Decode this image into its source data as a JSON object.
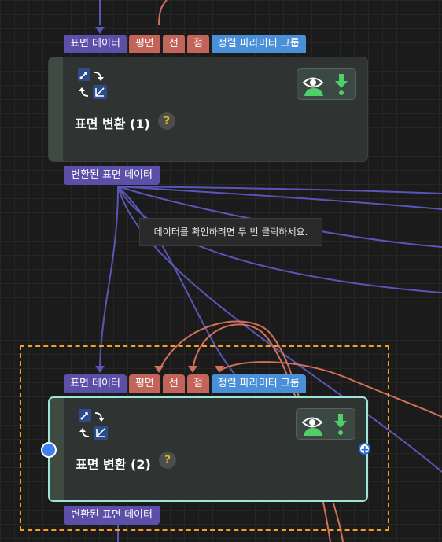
{
  "colors": {
    "surface_port": "#5b4fa8",
    "geometry_port": "#c3645a",
    "param_port": "#4a90d9",
    "wire_blue": "#5a56b8",
    "wire_red": "#d0715c",
    "selection": "#f5a023",
    "selected_border": "#9fe6da"
  },
  "tooltip": {
    "text": "데이터를 확인하려면 두 번 클릭하세요."
  },
  "nodes": [
    {
      "inputs": {
        "surface": "표면 데이터",
        "plane": "평면",
        "line": "선",
        "point": "점",
        "params": "정렬 파라미터 그룹"
      },
      "title": "표면 변환 (1)",
      "help": "?",
      "output": "변환된 표면 데이터",
      "icons": [
        "transform-icon",
        "eye-icon",
        "download-icon"
      ]
    },
    {
      "inputs": {
        "surface": "표면 데이터",
        "plane": "평면",
        "line": "선",
        "point": "점",
        "params": "정렬 파라미터 그룹"
      },
      "title": "표면 변환 (2)",
      "help": "?",
      "output": "변환된 표면 데이터",
      "right_port": "+",
      "icons": [
        "transform-icon",
        "eye-icon",
        "download-icon",
        "add-port-icon"
      ]
    }
  ]
}
